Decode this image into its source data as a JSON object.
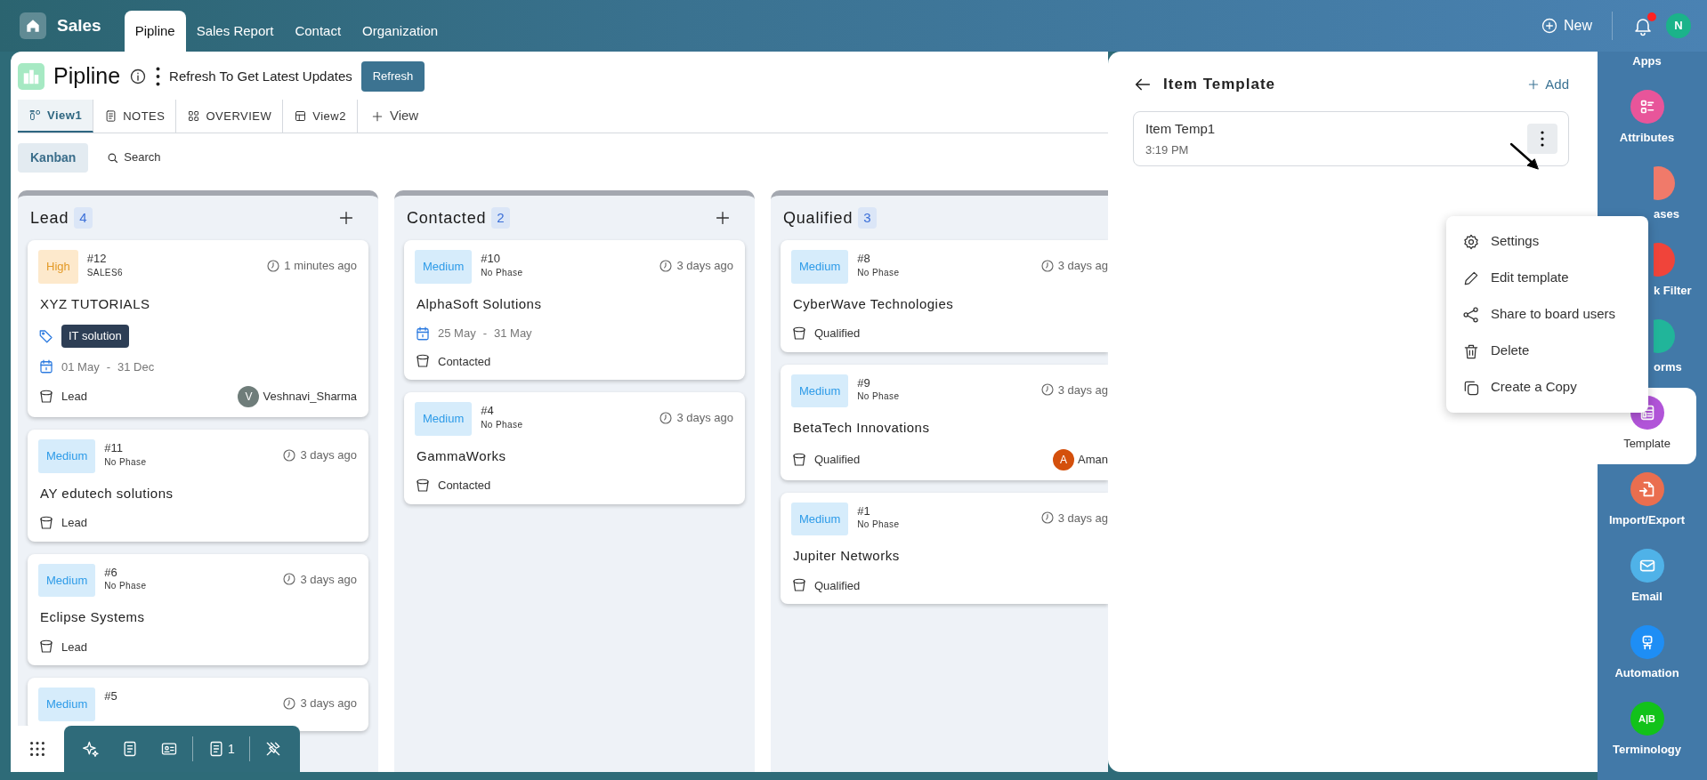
{
  "top_bar": {
    "app": "Sales",
    "tabs": [
      {
        "label": "Pipline",
        "selected": true
      },
      {
        "label": "Sales Report",
        "selected": false
      },
      {
        "label": "Contact",
        "selected": false
      },
      {
        "label": "Organization",
        "selected": false
      }
    ],
    "new_button": "New",
    "notification_dot": true,
    "avatar": {
      "initial": "N",
      "color": "#1bb38a"
    }
  },
  "board": {
    "title": "Pipline",
    "refresh_hint": "Refresh To Get Latest Updates",
    "refresh_button": "Refresh",
    "view_tabs": [
      {
        "label": "View1",
        "selected": true
      },
      {
        "label": "NOTES",
        "selected": false
      },
      {
        "label": "OVERVIEW",
        "selected": false
      },
      {
        "label": "View2",
        "selected": false
      }
    ],
    "add_view": "View",
    "view_mode": "Kanban",
    "search": "Search",
    "columns": [
      {
        "name": "Lead",
        "count": "4",
        "add_icon": true,
        "cards": [
          {
            "priority": {
              "label": "High",
              "kind": "high"
            },
            "number": "#12",
            "phase": "SALES6",
            "time": "1 minutes ago",
            "title": "XYZ TUTORIALS",
            "tags": [
              "IT solution"
            ],
            "dates": {
              "start": "01 May",
              "separator": "-",
              "end": "31 Dec"
            },
            "stage": "Lead",
            "assignee": {
              "initial": "V",
              "name": "Veshnavi_Sharma",
              "color": "#6f7d7a"
            }
          },
          {
            "priority": {
              "label": "Medium",
              "kind": "medium"
            },
            "number": "#11",
            "phase": "No Phase",
            "time": "3 days ago",
            "title": "AY edutech solutions",
            "stage": "Lead"
          },
          {
            "priority": {
              "label": "Medium",
              "kind": "medium"
            },
            "number": "#6",
            "phase": "No Phase",
            "time": "3 days ago",
            "title": "Eclipse Systems",
            "stage": "Lead"
          },
          {
            "priority": {
              "label": "Medium",
              "kind": "medium"
            },
            "number": "#5",
            "time": "3 days ago"
          }
        ]
      },
      {
        "name": "Contacted",
        "count": "2",
        "add_icon": true,
        "cards": [
          {
            "priority": {
              "label": "Medium",
              "kind": "medium"
            },
            "number": "#10",
            "phase": "No Phase",
            "time": "3 days ago",
            "title": "AlphaSoft Solutions",
            "dates": {
              "start": "25 May",
              "separator": "-",
              "end": "31 May"
            },
            "stage": "Contacted"
          },
          {
            "priority": {
              "label": "Medium",
              "kind": "medium"
            },
            "number": "#4",
            "phase": "No Phase",
            "time": "3 days ago",
            "title": "GammaWorks",
            "stage": "Contacted"
          }
        ]
      },
      {
        "name": "Qualified",
        "count": "3",
        "add_icon": false,
        "cards": [
          {
            "priority": {
              "label": "Medium",
              "kind": "medium"
            },
            "number": "#8",
            "phase": "No Phase",
            "time": "3 days ag",
            "title": "CyberWave Technologies",
            "stage": "Qualified"
          },
          {
            "priority": {
              "label": "Medium",
              "kind": "medium"
            },
            "number": "#9",
            "phase": "No Phase",
            "time": "3 days ag",
            "title": "BetaTech Innovations",
            "stage": "Qualified",
            "assignee": {
              "initial": "A",
              "name": "Aman",
              "color": "#d4500c"
            }
          },
          {
            "priority": {
              "label": "Medium",
              "kind": "medium"
            },
            "number": "#1",
            "phase": "No Phase",
            "time": "3 days ag",
            "title": "Jupiter Networks",
            "stage": "Qualified"
          }
        ]
      }
    ]
  },
  "bottom_toolbar": {
    "items": [
      {
        "kind": "pinned"
      },
      {
        "kind": "tool",
        "divider_before": false
      },
      {
        "kind": "tool",
        "divider_before": false
      },
      {
        "kind": "tool",
        "divider_before": false
      },
      {
        "kind": "tool",
        "divider_before": true,
        "count": "1"
      },
      {
        "kind": "tool",
        "divider_before": true
      }
    ]
  },
  "panel": {
    "title": "Item Template",
    "add": "Add",
    "templates": [
      {
        "name": "Item Temp1",
        "time": "3:19 PM",
        "menu_open": true
      }
    ],
    "menu": [
      {
        "label": "Settings"
      },
      {
        "label": "Edit template"
      },
      {
        "label": "Share to board users"
      },
      {
        "label": "Delete"
      },
      {
        "label": "Create a Copy"
      }
    ]
  },
  "sidebar": {
    "items": [
      {
        "label": "Apps",
        "kind": "full",
        "selected": false
      },
      {
        "label": "Attributes",
        "kind": "full",
        "color": "#e8559a",
        "selected": false
      },
      {
        "label": "ases",
        "kind": "covered",
        "color": "#f07a6a",
        "selected": false
      },
      {
        "label": "k Filter",
        "kind": "covered",
        "color": "#f0443a",
        "selected": false
      },
      {
        "label": "orms",
        "kind": "covered",
        "color": "#21b59a",
        "selected": false
      },
      {
        "label": "Template",
        "kind": "full",
        "color": "#b154d8",
        "selected": true
      },
      {
        "label": "Import/Export",
        "kind": "full",
        "color": "#ea6e4f",
        "selected": false
      },
      {
        "label": "Email",
        "kind": "full",
        "color": "#4fb2e8",
        "selected": false
      },
      {
        "label": "Automation",
        "kind": "full",
        "color": "#1e8ef5",
        "selected": false
      },
      {
        "label": "Terminology",
        "kind": "full",
        "color": "#12c21a",
        "icon_text": "A|B",
        "selected": false
      }
    ]
  }
}
